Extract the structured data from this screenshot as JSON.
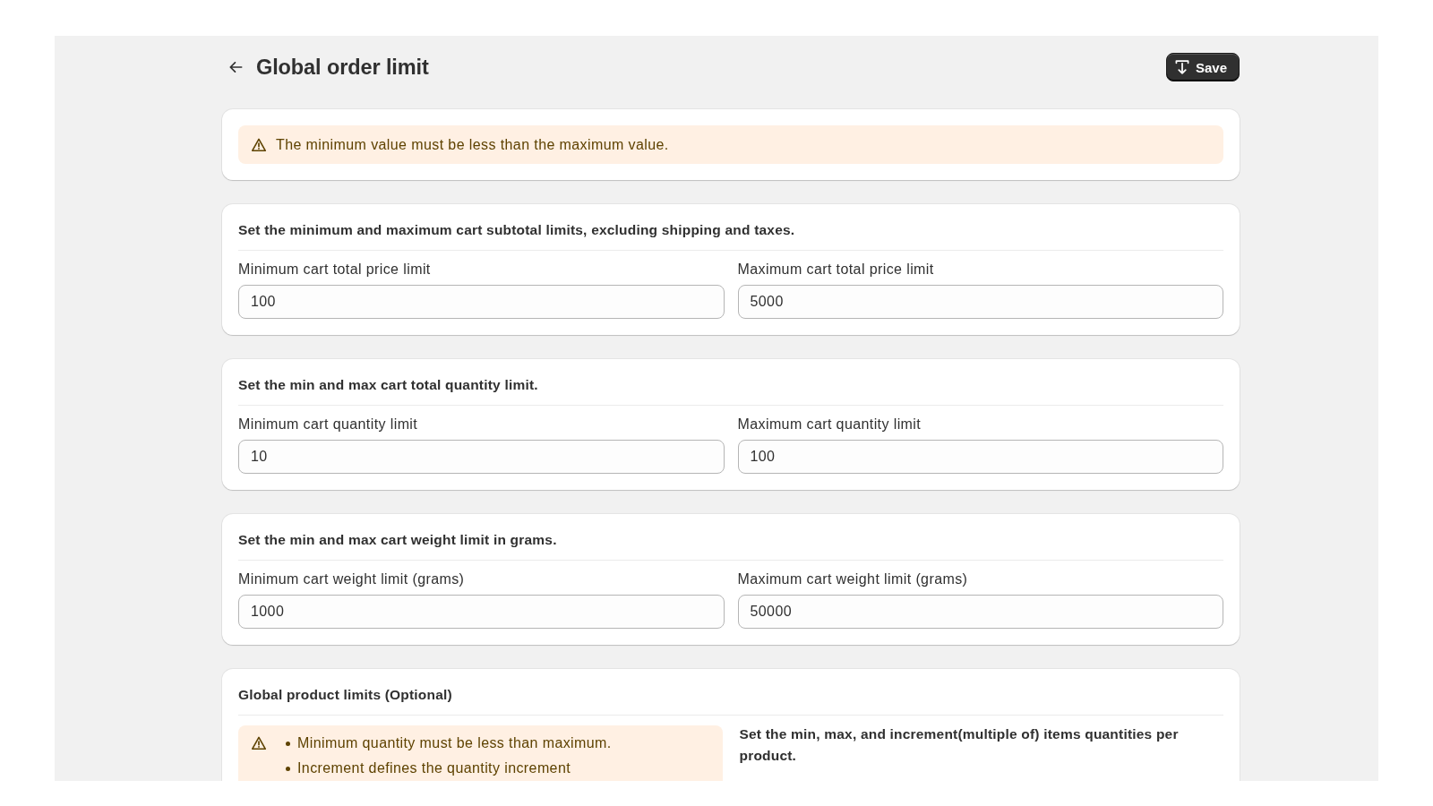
{
  "header": {
    "title": "Global order limit",
    "save_button": "Save"
  },
  "alert": {
    "message": "The minimum value must be less than the maximum value."
  },
  "sections": [
    {
      "heading": "Set the minimum and maximum cart subtotal limits, excluding shipping and taxes.",
      "fields": [
        {
          "label": "Minimum cart total price limit",
          "value": "100"
        },
        {
          "label": "Maximum cart total price limit",
          "value": "5000"
        }
      ]
    },
    {
      "heading": "Set the min and max cart total quantity limit.",
      "fields": [
        {
          "label": "Minimum cart quantity limit",
          "value": "10"
        },
        {
          "label": "Maximum cart quantity limit",
          "value": "100"
        }
      ]
    },
    {
      "heading": "Set the min and max cart weight limit in grams.",
      "fields": [
        {
          "label": "Minimum cart weight limit (grams)",
          "value": "1000"
        },
        {
          "label": "Maximum cart weight limit (grams)",
          "value": "50000"
        }
      ]
    }
  ],
  "product_limits": {
    "heading": "Global product limits (Optional)",
    "notes": [
      "Minimum quantity must be less than maximum.",
      "Increment defines the quantity increment"
    ],
    "description": "Set the min, max, and increment(multiple of) items quantities per product."
  }
}
